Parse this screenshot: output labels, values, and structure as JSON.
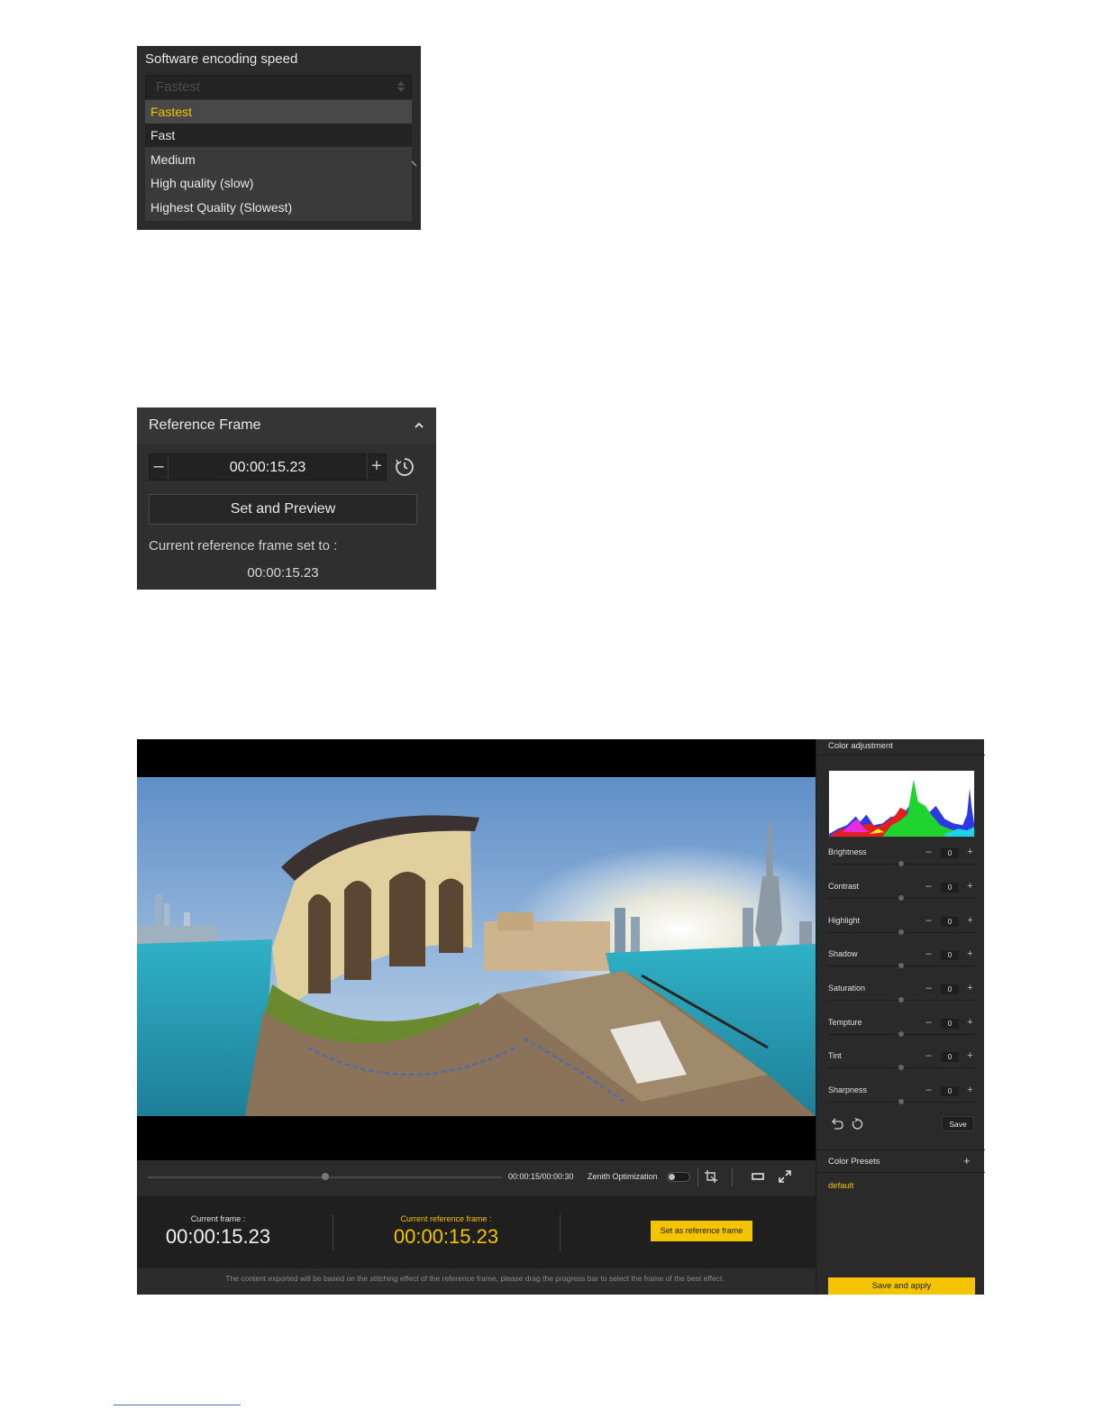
{
  "encoding_panel": {
    "title": "Software encoding speed",
    "selected_value": "Fastest",
    "options": [
      "Fastest",
      "Fast",
      "Medium",
      "High quality (slow)",
      "Highest Quality (Slowest)"
    ],
    "highlight_color": "#f5c400"
  },
  "reference_panel": {
    "title": "Reference Frame",
    "stepper_minus": "–",
    "stepper_plus": "+",
    "time_value": "00:00:15.23",
    "set_button": "Set and Preview",
    "current_label": "Current reference frame set to :",
    "current_value": "00:00:15.23",
    "icons": [
      "chevron-up-icon",
      "clock-icon"
    ]
  },
  "editor": {
    "timeline": {
      "time": "00:00:15/00:00:30",
      "progress": 0.5,
      "zenith_label": "Zenith Optimization",
      "zenith_on": false
    },
    "frames": {
      "current_label": "Current frame :",
      "current_value": "00:00:15.23",
      "reference_label": "Current reference frame :",
      "reference_value": "00:00:15.23",
      "set_button": "Set as reference frame"
    },
    "note": "The content exported will be based on the stitching effect of the reference frame, please drag the progress bar to select the frame of the best effect.",
    "side": {
      "title": "Color adjustment",
      "adjustments": [
        {
          "name": "Brightness",
          "value": "0"
        },
        {
          "name": "Contrast",
          "value": "0"
        },
        {
          "name": "Highlight",
          "value": "0"
        },
        {
          "name": "Shadow",
          "value": "0"
        },
        {
          "name": "Saturation",
          "value": "0"
        },
        {
          "name": "Tempture",
          "value": "0"
        },
        {
          "name": "Tint",
          "value": "0"
        },
        {
          "name": "Sharpness",
          "value": "0"
        }
      ],
      "minus": "–",
      "plus": "+",
      "save": "Save",
      "presets_title": "Color Presets",
      "add_preset": "+",
      "preset_default": "default",
      "save_apply": "Save and apply"
    },
    "accent_color": "#f5c400"
  }
}
